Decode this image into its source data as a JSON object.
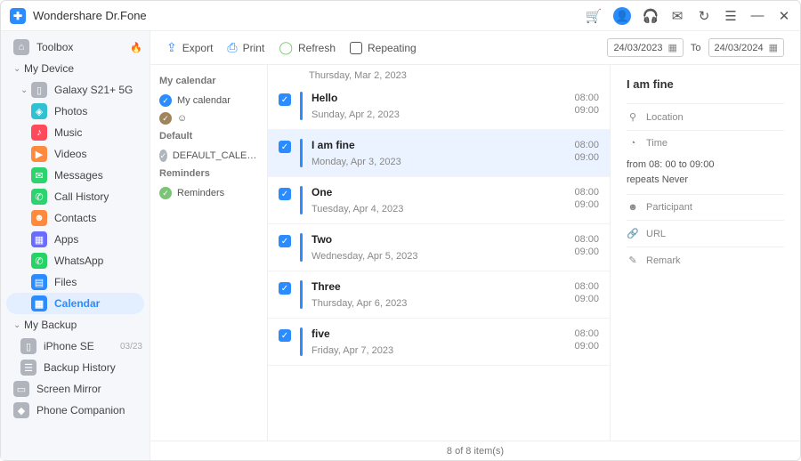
{
  "app": {
    "title": "Wondershare Dr.Fone"
  },
  "titlebar_icons": [
    "cart",
    "user",
    "headset",
    "mail",
    "history",
    "list",
    "minimize",
    "close"
  ],
  "sidebar": {
    "items": [
      {
        "label": "Toolbox",
        "icon": "home",
        "badge": "🔥"
      },
      {
        "label": "My Device",
        "icon": "device",
        "expandable": true
      },
      {
        "label": "Galaxy S21+ 5G",
        "icon": "phone",
        "level": 1,
        "expandable": true
      },
      {
        "label": "Photos",
        "icon": "photos",
        "color": "#2fc1d1",
        "level": 2
      },
      {
        "label": "Music",
        "icon": "music",
        "color": "#ff4a5b",
        "level": 2
      },
      {
        "label": "Videos",
        "icon": "videos",
        "color": "#ff8a3d",
        "level": 2
      },
      {
        "label": "Messages",
        "icon": "messages",
        "color": "#2dd36f",
        "level": 2
      },
      {
        "label": "Call History",
        "icon": "call",
        "color": "#2dd36f",
        "level": 2
      },
      {
        "label": "Contacts",
        "icon": "contacts",
        "color": "#ff8a3d",
        "level": 2
      },
      {
        "label": "Apps",
        "icon": "apps",
        "color": "#6a6cff",
        "level": 2
      },
      {
        "label": "WhatsApp",
        "icon": "whatsapp",
        "color": "#25d366",
        "level": 2
      },
      {
        "label": "Files",
        "icon": "files",
        "color": "#2b8cff",
        "level": 2
      },
      {
        "label": "Calendar",
        "icon": "calendar",
        "color": "#2b8cff",
        "level": 2,
        "active": true
      },
      {
        "label": "My Backup",
        "icon": "backup",
        "expandable": true
      },
      {
        "label": "iPhone SE",
        "icon": "iphone",
        "level": 1,
        "meta": "03/23"
      },
      {
        "label": "Backup History",
        "icon": "history",
        "level": 1
      },
      {
        "label": "Screen Mirror",
        "icon": "mirror"
      },
      {
        "label": "Phone Companion",
        "icon": "companion"
      }
    ]
  },
  "toolbar": {
    "export": "Export",
    "print": "Print",
    "refresh": "Refresh",
    "repeating": "Repeating",
    "date_from": "24/03/2023",
    "date_to": "24/03/2024",
    "to_label": "To"
  },
  "calendars": {
    "groups": [
      {
        "head": "My calendar",
        "items": [
          {
            "color": "blue",
            "label": "My calendar"
          },
          {
            "color": "brown",
            "label": "☺"
          }
        ]
      },
      {
        "head": "Default",
        "items": [
          {
            "color": "grey",
            "label": "DEFAULT_CALENDAR_NAME"
          }
        ]
      },
      {
        "head": "Reminders",
        "items": [
          {
            "color": "green",
            "label": "Reminders"
          }
        ]
      }
    ]
  },
  "events": {
    "top_date": "Thursday, Mar 2, 2023",
    "list": [
      {
        "title": "Hello",
        "date": "Sunday, Apr 2, 2023",
        "t1": "08:00",
        "t2": "09:00"
      },
      {
        "title": "I am fine",
        "date": "Monday, Apr 3, 2023",
        "t1": "08:00",
        "t2": "09:00",
        "selected": true
      },
      {
        "title": "One",
        "date": "Tuesday, Apr 4, 2023",
        "t1": "08:00",
        "t2": "09:00"
      },
      {
        "title": "Two",
        "date": "Wednesday, Apr 5, 2023",
        "t1": "08:00",
        "t2": "09:00"
      },
      {
        "title": "Three",
        "date": "Thursday, Apr 6, 2023",
        "t1": "08:00",
        "t2": "09:00"
      },
      {
        "title": "five",
        "date": "Friday, Apr 7, 2023",
        "t1": "08:00",
        "t2": "09:00"
      }
    ]
  },
  "details": {
    "title": "I am fine",
    "location_label": "Location",
    "time_label": "Time",
    "time_text1": "from 08: 00 to 09:00",
    "time_text2": "repeats Never",
    "participant_label": "Participant",
    "url_label": "URL",
    "remark_label": "Remark"
  },
  "footer": {
    "text": "8  of  8 item(s)"
  }
}
